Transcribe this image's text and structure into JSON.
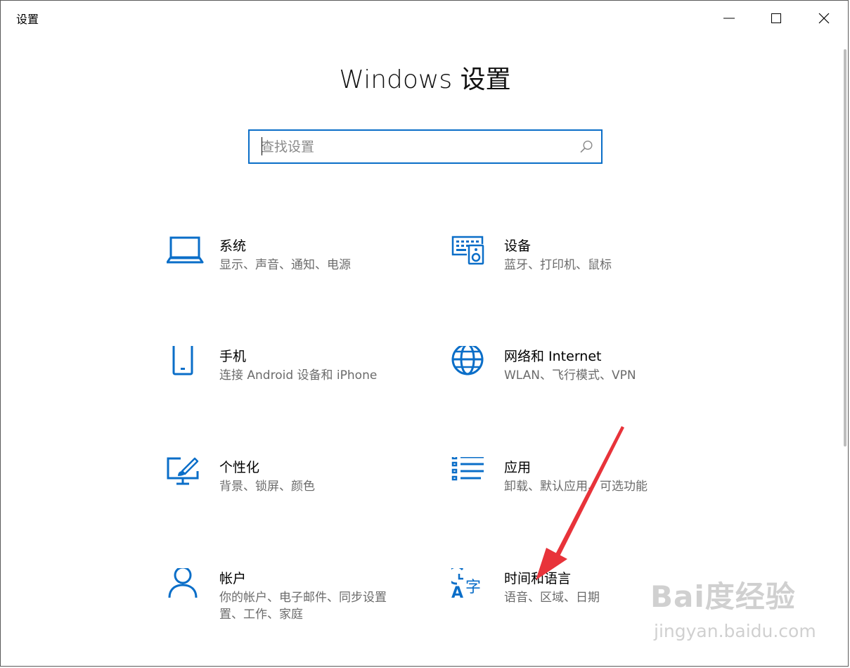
{
  "window": {
    "title": "设置",
    "controls": {
      "minimize": "minimize-icon",
      "maximize": "maximize-icon",
      "close": "close-icon"
    }
  },
  "page": {
    "title": "Windows 设置"
  },
  "search": {
    "placeholder": "查找设置",
    "value": ""
  },
  "tiles": [
    {
      "title": "系统",
      "subtitle": "显示、声音、通知、电源",
      "icon": "laptop-icon"
    },
    {
      "title": "设备",
      "subtitle": "蓝牙、打印机、鼠标",
      "icon": "keyboard-speaker-icon"
    },
    {
      "title": "手机",
      "subtitle": "连接 Android 设备和 iPhone",
      "icon": "phone-icon"
    },
    {
      "title": "网络和 Internet",
      "subtitle": "WLAN、飞行模式、VPN",
      "icon": "globe-icon"
    },
    {
      "title": "个性化",
      "subtitle": "背景、锁屏、颜色",
      "icon": "brush-monitor-icon"
    },
    {
      "title": "应用",
      "subtitle": "卸载、默认应用、可选功能",
      "icon": "app-list-icon"
    },
    {
      "title": "帐户",
      "subtitle": "你的帐户、电子邮件、同步设置",
      "subtitle2": "置、工作、家庭",
      "icon": "person-icon"
    },
    {
      "title": "时间和语言",
      "subtitle": "语音、区域、日期",
      "icon": "clock-language-icon"
    }
  ],
  "watermark": {
    "logo": "Bai度经验",
    "url": "jingyan.baidu.com"
  },
  "colors": {
    "accent": "#0a6ec8",
    "arrow": "#e8333a",
    "subtitle": "#6b6b6b"
  }
}
